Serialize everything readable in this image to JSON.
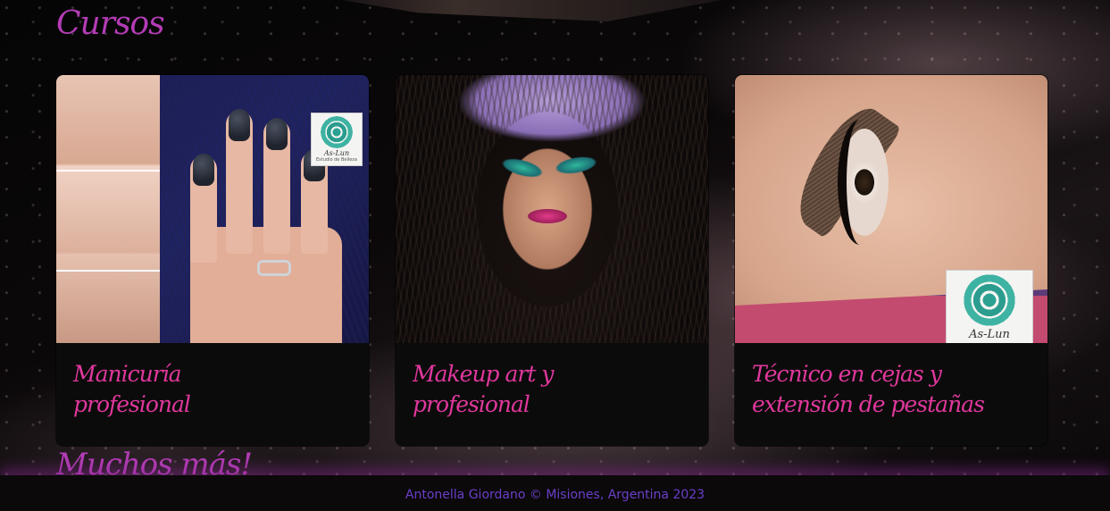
{
  "sections": {
    "courses_title": "Cursos",
    "more_title": "Muchos más!"
  },
  "courses": [
    {
      "title": "Manicuría profesional",
      "image": "nails-photo"
    },
    {
      "title": "Makeup art y profesional",
      "image": "makeup-photo"
    },
    {
      "title": "Técnico en cejas y extensión de pestañas",
      "image": "brows-photo"
    }
  ],
  "logos": {
    "brand_name": "As-Lun",
    "brand_sub": "Estudio de Belleza"
  },
  "footer": {
    "text": "Antonella Giordano © Misiones, Argentina 2023"
  },
  "colors": {
    "title_accent": "#b33cb5",
    "card_title": "#e0389d",
    "footer_text": "#6a3fc9",
    "card_bg": "#0b0b0b"
  }
}
